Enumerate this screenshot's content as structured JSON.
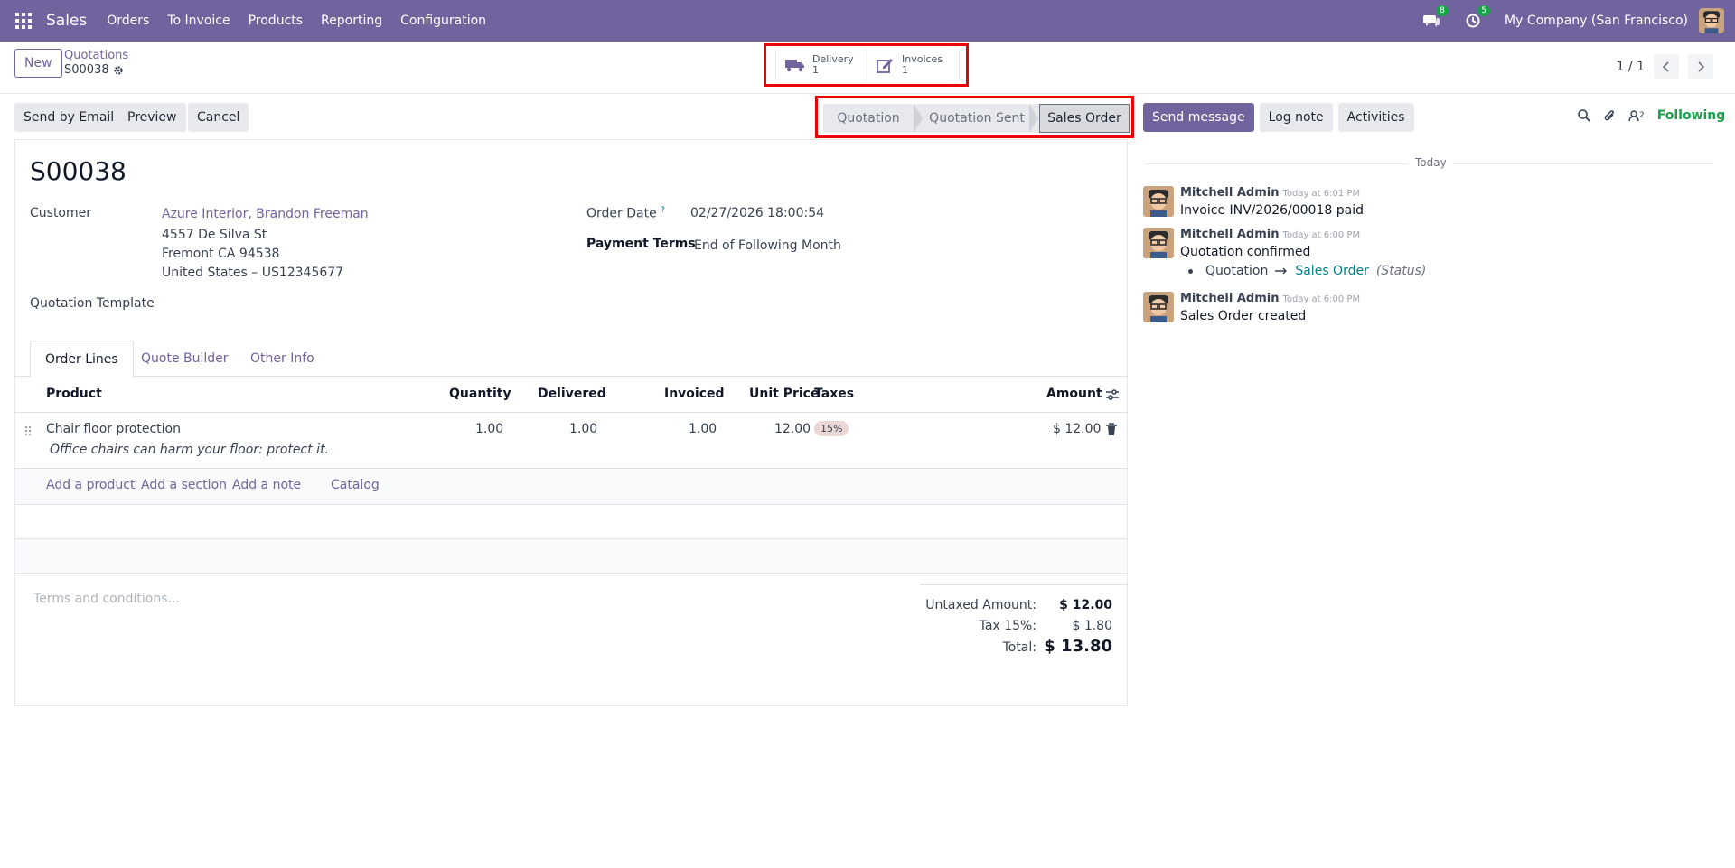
{
  "navbar": {
    "app_name": "Sales",
    "menu": [
      "Orders",
      "To Invoice",
      "Products",
      "Reporting",
      "Configuration"
    ],
    "messages_count": "8",
    "activities_count": "5",
    "company": "My Company (San Francisco)"
  },
  "control_panel": {
    "new_label": "New",
    "breadcrumb": "Quotations",
    "record_name": "S00038",
    "smart_buttons": [
      {
        "label": "Delivery",
        "value": "1",
        "icon": "truck-icon"
      },
      {
        "label": "Invoices",
        "value": "1",
        "icon": "pencil-square-icon"
      }
    ],
    "pager": "1 / 1"
  },
  "actions": {
    "send_email": "Send by Email",
    "preview": "Preview",
    "cancel": "Cancel"
  },
  "statusbar": {
    "stages": [
      "Quotation",
      "Quotation Sent",
      "Sales Order"
    ],
    "current": "Sales Order"
  },
  "form": {
    "title": "S00038",
    "customer_label": "Customer",
    "customer_name": "Azure Interior, Brandon Freeman",
    "address_line1": "4557 De Silva St",
    "address_line2": "Fremont CA 94538",
    "address_line3": "United States – US12345677",
    "template_label": "Quotation Template",
    "order_date_label": "Order Date",
    "order_date_help": "?",
    "order_date": "02/27/2026 18:00:54",
    "payment_terms_label": "Payment Terms",
    "payment_terms": "End of Following Month"
  },
  "tabs": [
    "Order Lines",
    "Quote Builder",
    "Other Info"
  ],
  "order_lines": {
    "headers": {
      "product": "Product",
      "quantity": "Quantity",
      "delivered": "Delivered",
      "invoiced": "Invoiced",
      "unit_price": "Unit Price",
      "taxes": "Taxes",
      "amount": "Amount"
    },
    "rows": [
      {
        "product": "Chair floor protection",
        "description": "Office chairs can harm your floor: protect it.",
        "quantity": "1.00",
        "delivered": "1.00",
        "invoiced": "1.00",
        "unit_price": "12.00",
        "tax": "15%",
        "amount": "$ 12.00"
      }
    ],
    "add_links": [
      "Add a product",
      "Add a section",
      "Add a note",
      "Catalog"
    ]
  },
  "terms_placeholder": "Terms and conditions...",
  "totals": {
    "untaxed_label": "Untaxed Amount:",
    "untaxed_value": "$ 12.00",
    "tax_label": "Tax 15%:",
    "tax_value": "$ 1.80",
    "total_label": "Total:",
    "total_value": "$ 13.80"
  },
  "chatter": {
    "send_message": "Send message",
    "log_note": "Log note",
    "activities": "Activities",
    "followers_count": "2",
    "following": "Following",
    "date_separator": "Today",
    "messages": [
      {
        "author": "Mitchell Admin",
        "time": "Today at 6:01 PM",
        "body": "Invoice INV/2026/00018 paid"
      },
      {
        "author": "Mitchell Admin",
        "time": "Today at 6:00 PM",
        "body": "Quotation confirmed",
        "tracking": {
          "old": "Quotation",
          "new": "Sales Order",
          "field": "(Status)"
        }
      },
      {
        "author": "Mitchell Admin",
        "time": "Today at 6:00 PM",
        "body": "Sales Order created"
      }
    ]
  },
  "colors": {
    "brand": "#71639e",
    "highlight_box": "#ef0000",
    "following": "#16a34a"
  }
}
